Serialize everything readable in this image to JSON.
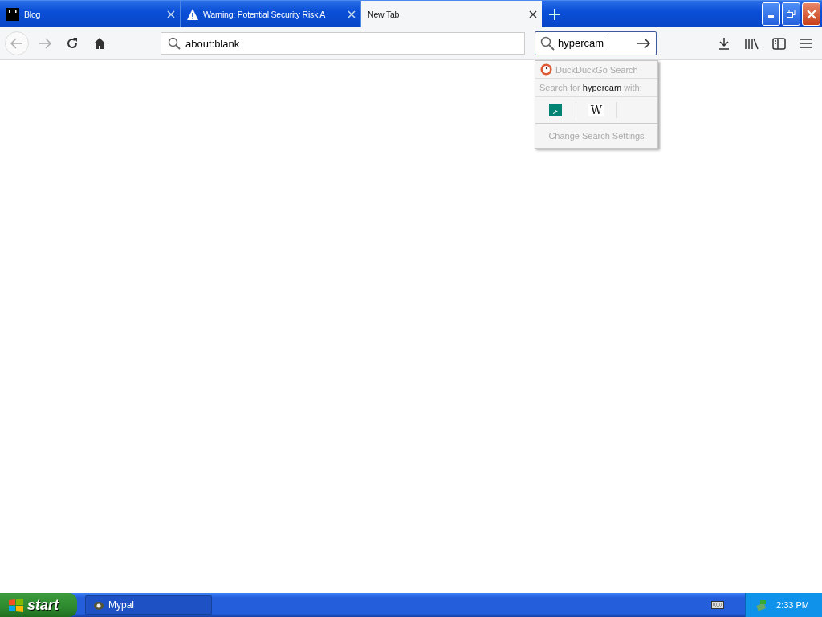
{
  "tabs": [
    {
      "title": "Blog",
      "kind": "blog",
      "selected": false
    },
    {
      "title": "Warning: Potential Security Risk A",
      "kind": "warning",
      "selected": false
    },
    {
      "title": "New Tab",
      "kind": "blank",
      "selected": true
    }
  ],
  "toolbar": {
    "back_disabled": true,
    "forward_disabled": true,
    "address": "about:blank"
  },
  "search": {
    "value": "hypercam"
  },
  "search_popup": {
    "engine": "DuckDuckGo Search",
    "prompt": "Search for **hypercam** with:",
    "engines": [
      {
        "kind": "bing"
      },
      {
        "kind": "wiki",
        "glyph": "W"
      }
    ],
    "settings": "Change Search Settings"
  },
  "taskbar": {
    "start": "start",
    "tasks": [
      {
        "title": "Mypal"
      }
    ],
    "clock": "2:33 PM"
  }
}
